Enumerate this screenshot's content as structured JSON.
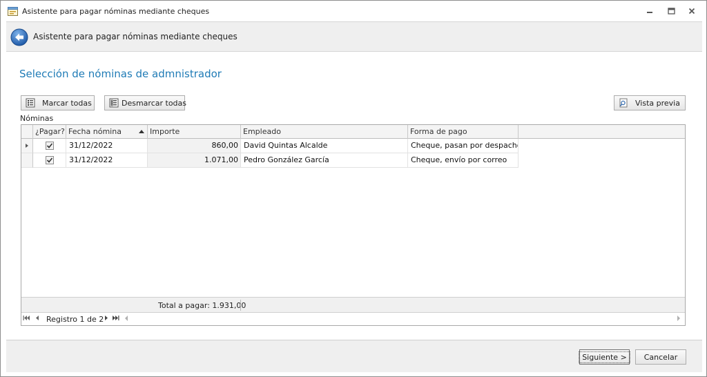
{
  "window": {
    "title": "Asistente para pagar nóminas mediante cheques"
  },
  "header": {
    "title": "Asistente para pagar nóminas mediante cheques"
  },
  "page": {
    "section_title": "Selección de nóminas de admnistrador"
  },
  "toolbar": {
    "select_all_label": "Marcar todas",
    "deselect_all_label": "Desmarcar todas",
    "preview_label": "Vista previa"
  },
  "grid": {
    "caption": "Nóminas",
    "columns": {
      "pay": "¿Pagar?",
      "date": "Fecha nómina",
      "amount": "Importe",
      "employee": "Empleado",
      "payment_method": "Forma de pago"
    },
    "rows": [
      {
        "pay": true,
        "date": "31/12/2022",
        "amount": "860,00",
        "employee": "David Quintas Alcalde",
        "payment_method": "Cheque, pasan por despacho"
      },
      {
        "pay": true,
        "date": "31/12/2022",
        "amount": "1.071,00",
        "employee": "Pedro González García",
        "payment_method": "Cheque, envío por correo"
      }
    ],
    "footer_total": "Total a pagar: 1.931,00",
    "navigator_text": "Registro 1 de 2"
  },
  "footer": {
    "next_label": "Siguiente >",
    "cancel_label": "Cancelar"
  },
  "colors": {
    "accent_title": "#1f7bb6",
    "band_background": "#efefef"
  }
}
